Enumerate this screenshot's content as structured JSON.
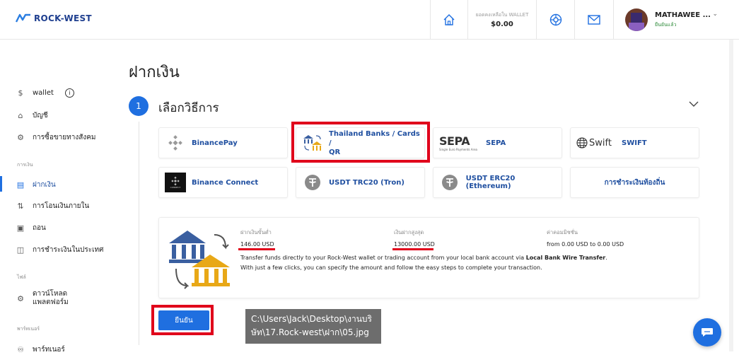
{
  "brand": {
    "name": "ROCK-WEST",
    "color": "#1f3f8f"
  },
  "header": {
    "wallet_label": "ยอดคงเหลือใน WALLET",
    "wallet_value": "$0.00",
    "user_name": "MATHAWEE ...",
    "user_status": "ยืนยันแล้ว"
  },
  "sidebar": {
    "items_top": [
      {
        "label": "wallet",
        "icon": "dollar-icon"
      },
      {
        "label": "บัญชี",
        "icon": "home-icon"
      },
      {
        "label": "การซื้อขายทางสังคม",
        "icon": "gear-icon"
      }
    ],
    "section_money": "การเงิน",
    "items_money": [
      {
        "label": "ฝากเงิน",
        "icon": "wallet-icon",
        "active": true
      },
      {
        "label": "การโอนเงินภายใน",
        "icon": "transfer-icon"
      },
      {
        "label": "ถอน",
        "icon": "withdraw-icon"
      },
      {
        "label": "การชำระเงินในประเทศ",
        "icon": "payment-icon"
      }
    ],
    "section_files": "ไฟล์",
    "download_label_1": "ดาวน์โหลด",
    "download_label_2": "แพลตฟอร์ม",
    "section_partner": "พาร์ทเนอร์",
    "partner_label": "พาร์ทเนอร์"
  },
  "main": {
    "page_title": "ฝากเงิน",
    "step_number": "1",
    "step_title": "เลือกวิธีการ",
    "methods": [
      {
        "label": "BinancePay"
      },
      {
        "label": "Thailand Banks / Cards /",
        "label2": "QR"
      },
      {
        "label": "SEPA"
      },
      {
        "label": "SWIFT"
      },
      {
        "label": "Binance Connect"
      },
      {
        "label": "USDT TRC20 (Tron)"
      },
      {
        "label": "USDT ERC20 (Ethereum)"
      },
      {
        "label": "การชำระเงินท้องถิ่น"
      }
    ],
    "sepa_logo_text": "SEPA",
    "sepa_sub_text": "Single Euro Payments Area",
    "swift_logo_text": "Swift",
    "binance_connect_logo": "CONNECT",
    "info": {
      "min_label": "ฝากเงินขั้นต่ำ",
      "min_value": "146.00 USD",
      "max_label": "เงินฝากสูงสุด",
      "max_value": "13000.00 USD",
      "fee_label": "ค่าคอมมิชชั่น",
      "fee_value": "from 0.00 USD to 0.00 USD",
      "desc_1a": "Transfer funds directly to your Rock-West wallet or trading account from your local bank account via ",
      "desc_1b": "Local Bank Wire Transfer",
      "desc_1c": ".",
      "desc_2": "With just a few clicks, you can specify the amount and follow the easy steps to complete your transaction."
    },
    "confirm_label": "ยืนยัน"
  },
  "tooltip": {
    "line1": "C:\\Users\\Jack\\Desktop\\งานบริ",
    "line2": "ษัท\\17.Rock-west\\ฝาก\\05.jpg"
  },
  "colors": {
    "accent": "#1f6fe0",
    "highlight": "#e0001b",
    "sidebar_active": "#1f4fa0"
  }
}
